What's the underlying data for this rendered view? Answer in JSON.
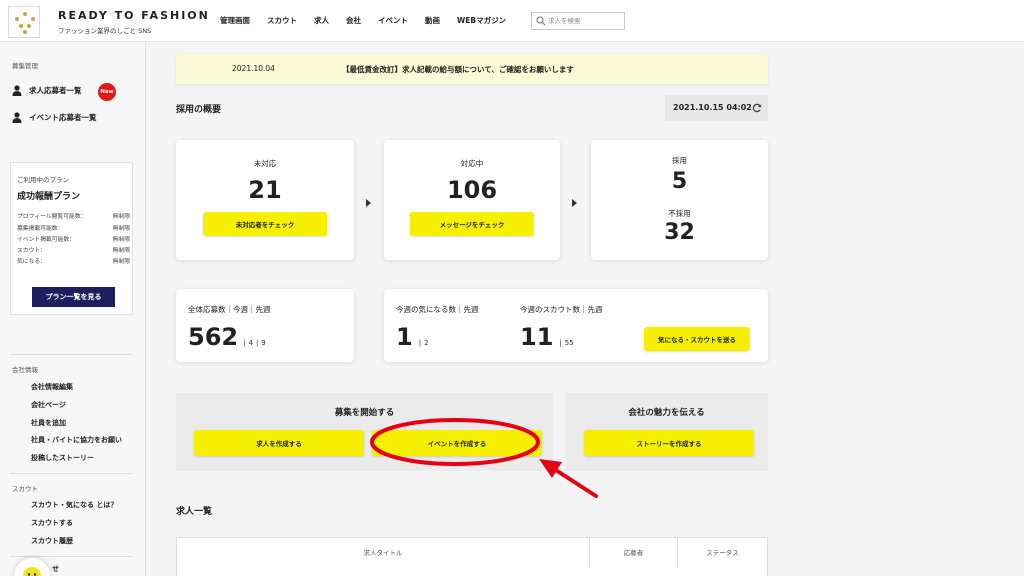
{
  "header": {
    "brand": "READY TO FASHION",
    "brand_sub": "ファッション業界のしごと SNS",
    "nav": [
      "管理画面",
      "スカウト",
      "求人",
      "会社",
      "イベント",
      "動画",
      "WEBマガジン"
    ],
    "search_placeholder": "求人を検索"
  },
  "sidebar": {
    "recruit_label": "募集管理",
    "applicants": "求人応募者一覧",
    "new_badge": "New",
    "event_applicants": "イベント応募者一覧",
    "plan": {
      "current_label": "ご利用中のプラン",
      "name": "成功報酬プラン",
      "rows": [
        {
          "label": "プロフィール閲覧可能数：",
          "value": "無制限"
        },
        {
          "label": "募集掲載可能数：",
          "value": "無制限"
        },
        {
          "label": "イベント掲載可能数：",
          "value": "無制限"
        },
        {
          "label": "スカウト：",
          "value": "無制限"
        },
        {
          "label": "気になる：",
          "value": "無制限"
        }
      ],
      "button": "プラン一覧を見る"
    },
    "company_label": "会社情報",
    "company_links": [
      "会社情報編集",
      "会社ページ",
      "社員を追加",
      "社員・バイトに協力をお願い",
      "投稿したストーリー"
    ],
    "scout_label": "スカウト",
    "scout_links": [
      "スカウト・気になる とは？",
      "スカウトする",
      "スカウト履歴"
    ],
    "bottom_partial": "せ"
  },
  "notice": {
    "date": "2021.10.04",
    "text": "【最低賃金改訂】求人記載の給与額について、ご確認をお願いします"
  },
  "overview": {
    "title": "採用の概要",
    "timestamp": "2021.10.15 04:02",
    "unhandled": {
      "label": "未対応",
      "value": "21",
      "button": "未対応者をチェック"
    },
    "in_progress": {
      "label": "対応中",
      "value": "106",
      "button": "メッセージをチェック"
    },
    "hired": {
      "label": "採用",
      "value": "5"
    },
    "rejected": {
      "label": "不採用",
      "value": "32"
    }
  },
  "applications": {
    "label": "全体応募数｜今週｜先週",
    "total": "562",
    "this_week": "4",
    "last_week": "9"
  },
  "interest": {
    "label": "今週の気になる数｜先週",
    "this_week": "1",
    "last_week": "2"
  },
  "scouts": {
    "label": "今週のスカウト数｜先週",
    "this_week": "11",
    "last_week": "55",
    "button": "気になる・スカウトを送る"
  },
  "start_recruit": {
    "title": "募集を開始する",
    "create_job": "求人を作成する",
    "create_event": "イベントを作成する"
  },
  "appeal": {
    "title": "会社の魅力を伝える",
    "create_story": "ストーリーを作成する"
  },
  "job_list": {
    "title": "求人一覧",
    "columns": [
      "求人タイトル",
      "応募者",
      "ステータス"
    ]
  },
  "colors": {
    "accent_yellow": "#f6f000",
    "navy": "#1e1f5e",
    "badge_red": "#e01818",
    "annotation_red": "#e60012"
  }
}
